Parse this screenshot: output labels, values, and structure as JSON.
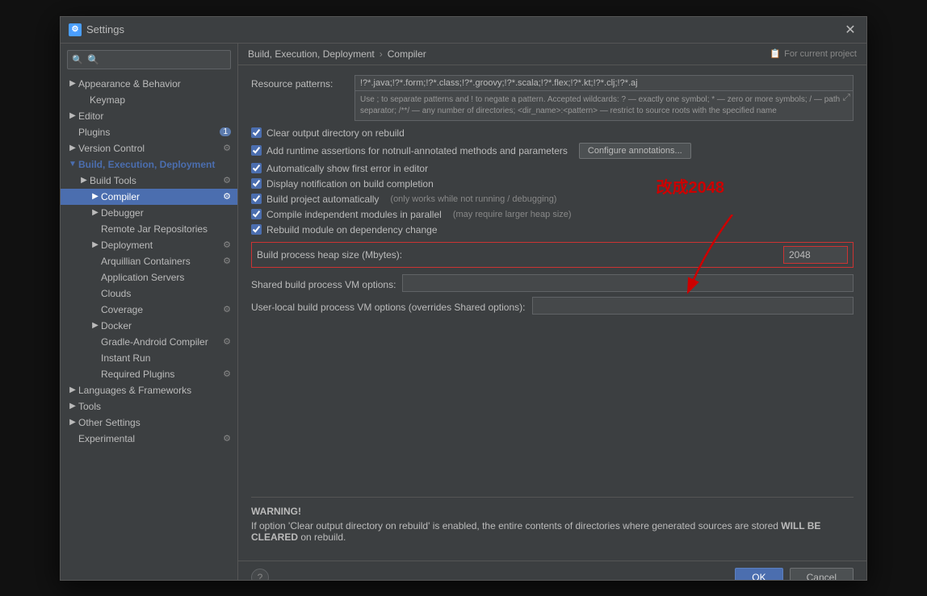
{
  "dialog": {
    "title": "Settings",
    "icon": "⚙",
    "close_label": "✕"
  },
  "sidebar": {
    "search_placeholder": "🔍",
    "items": [
      {
        "id": "appearance",
        "label": "Appearance & Behavior",
        "level": 0,
        "arrow": "▶",
        "selected": false
      },
      {
        "id": "keymap",
        "label": "Keymap",
        "level": 1,
        "selected": false
      },
      {
        "id": "editor",
        "label": "Editor",
        "level": 0,
        "arrow": "▶",
        "selected": false
      },
      {
        "id": "plugins",
        "label": "Plugins",
        "level": 0,
        "badge": "1",
        "selected": false
      },
      {
        "id": "version-control",
        "label": "Version Control",
        "level": 0,
        "arrow": "▶",
        "icon": "⚙",
        "selected": false
      },
      {
        "id": "build-execution",
        "label": "Build, Execution, Deployment",
        "level": 0,
        "arrow": "▼",
        "selected": false,
        "active_parent": true
      },
      {
        "id": "build-tools",
        "label": "Build Tools",
        "level": 1,
        "arrow": "▶",
        "icon": "⚙",
        "selected": false
      },
      {
        "id": "compiler",
        "label": "Compiler",
        "level": 2,
        "arrow": "▶",
        "selected": true
      },
      {
        "id": "debugger",
        "label": "Debugger",
        "level": 2,
        "arrow": "▶",
        "selected": false
      },
      {
        "id": "remote-jar",
        "label": "Remote Jar Repositories",
        "level": 2,
        "selected": false
      },
      {
        "id": "deployment",
        "label": "Deployment",
        "level": 2,
        "arrow": "▶",
        "icon": "⚙",
        "selected": false
      },
      {
        "id": "arquillian",
        "label": "Arquillian Containers",
        "level": 2,
        "icon": "⚙",
        "selected": false
      },
      {
        "id": "app-servers",
        "label": "Application Servers",
        "level": 2,
        "selected": false
      },
      {
        "id": "clouds",
        "label": "Clouds",
        "level": 2,
        "selected": false
      },
      {
        "id": "coverage",
        "label": "Coverage",
        "level": 2,
        "icon": "⚙",
        "selected": false
      },
      {
        "id": "docker",
        "label": "Docker",
        "level": 2,
        "arrow": "▶",
        "selected": false
      },
      {
        "id": "gradle-android",
        "label": "Gradle-Android Compiler",
        "level": 2,
        "icon": "⚙",
        "selected": false
      },
      {
        "id": "instant-run",
        "label": "Instant Run",
        "level": 2,
        "selected": false
      },
      {
        "id": "required-plugins",
        "label": "Required Plugins",
        "level": 2,
        "icon": "⚙",
        "selected": false
      },
      {
        "id": "languages",
        "label": "Languages & Frameworks",
        "level": 0,
        "arrow": "▶",
        "selected": false
      },
      {
        "id": "tools",
        "label": "Tools",
        "level": 0,
        "arrow": "▶",
        "selected": false
      },
      {
        "id": "other-settings",
        "label": "Other Settings",
        "level": 0,
        "arrow": "▶",
        "selected": false
      },
      {
        "id": "experimental",
        "label": "Experimental",
        "level": 0,
        "icon": "⚙",
        "selected": false
      }
    ]
  },
  "breadcrumb": {
    "parts": [
      "Build, Execution, Deployment",
      "Compiler"
    ],
    "separator": "›",
    "project_label": "For current project"
  },
  "content": {
    "resource_patterns": {
      "label": "Resource patterns:",
      "value": "!?*.java;!?*.form;!?*.class;!?*.groovy;!?*.scala;!?*.flex;!?*.kt;!?*.clj;!?*.aj",
      "help_text": "Use ; to separate patterns and ! to negate a pattern. Accepted wildcards: ? — exactly one symbol; * — zero or more symbols; / — path separator; /**/ — any number of directories; <dir_name>:<pattern> — restrict to source roots with the specified name"
    },
    "checkboxes": [
      {
        "id": "clear-output",
        "label": "Clear output directory on rebuild",
        "checked": true
      },
      {
        "id": "add-runtime",
        "label": "Add runtime assertions for notnull-annotated methods and parameters",
        "checked": true,
        "button": "Configure annotations..."
      },
      {
        "id": "auto-show-error",
        "label": "Automatically show first error in editor",
        "checked": true
      },
      {
        "id": "display-notification",
        "label": "Display notification on build completion",
        "checked": true
      },
      {
        "id": "build-auto",
        "label": "Build project automatically",
        "checked": true,
        "hint": "(only works while not running / debugging)"
      },
      {
        "id": "compile-parallel",
        "label": "Compile independent modules in parallel",
        "checked": true,
        "hint": "(may require larger heap size)"
      },
      {
        "id": "rebuild-dependency",
        "label": "Rebuild module on dependency change",
        "checked": true
      }
    ],
    "heap_size": {
      "label": "Build process heap size (Mbytes):",
      "value": "2048"
    },
    "shared_vm": {
      "label": "Shared build process VM options:",
      "value": ""
    },
    "user_local_vm": {
      "label": "User-local build process VM options (overrides Shared options):",
      "value": ""
    },
    "warning": {
      "title": "WARNING!",
      "text": "If option 'Clear output directory on rebuild' is enabled, the entire contents of directories where generated sources are stored WILL BE CLEARED on rebuild."
    }
  },
  "annotation": {
    "text": "改成2048"
  },
  "footer": {
    "ok_label": "OK",
    "cancel_label": "Cancel",
    "help_label": "?"
  }
}
